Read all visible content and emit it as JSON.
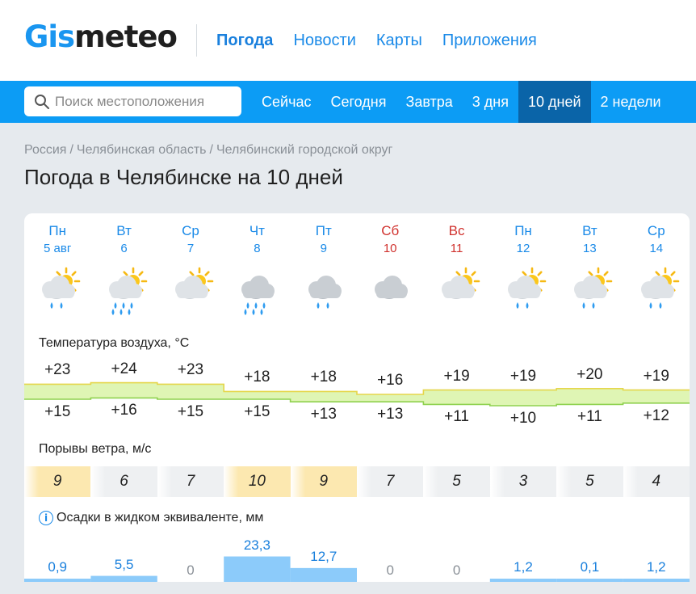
{
  "header": {
    "logo": {
      "part1": "Gis",
      "part2": "meteo"
    },
    "nav": [
      {
        "label": "Погода",
        "active": true
      },
      {
        "label": "Новости",
        "active": false
      },
      {
        "label": "Карты",
        "active": false
      },
      {
        "label": "Приложения",
        "active": false
      }
    ]
  },
  "subnav": {
    "search_placeholder": "Поиск местоположения",
    "search_icon": "search-icon",
    "tabs": [
      {
        "label": "Сейчас",
        "active": false
      },
      {
        "label": "Сегодня",
        "active": false
      },
      {
        "label": "Завтра",
        "active": false
      },
      {
        "label": "3 дня",
        "active": false
      },
      {
        "label": "10 дней",
        "active": true
      },
      {
        "label": "2 недели",
        "active": false
      }
    ]
  },
  "breadcrumb": [
    "Россия",
    "Челябинская область",
    "Челябинский городской округ"
  ],
  "breadcrumb_separator": "/",
  "page_title": "Погода в Челябинске на 10 дней",
  "forecast": {
    "days": [
      {
        "dow": "Пн",
        "date": "5 авг",
        "weekend": false,
        "icon": "partly-cloudy-rain-icon"
      },
      {
        "dow": "Вт",
        "date": "6",
        "weekend": false,
        "icon": "partly-cloudy-heavy-rain-icon"
      },
      {
        "dow": "Ср",
        "date": "7",
        "weekend": false,
        "icon": "partly-cloudy-icon"
      },
      {
        "dow": "Чт",
        "date": "8",
        "weekend": false,
        "icon": "cloudy-heavy-rain-icon"
      },
      {
        "dow": "Пт",
        "date": "9",
        "weekend": false,
        "icon": "cloudy-rain-icon"
      },
      {
        "dow": "Сб",
        "date": "10",
        "weekend": true,
        "icon": "cloudy-icon"
      },
      {
        "dow": "Вс",
        "date": "11",
        "weekend": true,
        "icon": "partly-cloudy-icon"
      },
      {
        "dow": "Пн",
        "date": "12",
        "weekend": false,
        "icon": "partly-cloudy-rain-icon"
      },
      {
        "dow": "Вт",
        "date": "13",
        "weekend": false,
        "icon": "partly-cloudy-rain-icon"
      },
      {
        "dow": "Ср",
        "date": "14",
        "weekend": false,
        "icon": "partly-cloudy-rain-icon"
      }
    ],
    "temperature": {
      "label": "Температура воздуха, °C",
      "max": [
        "+23",
        "+24",
        "+23",
        "+18",
        "+18",
        "+16",
        "+19",
        "+19",
        "+20",
        "+19"
      ],
      "min": [
        "+15",
        "+16",
        "+15",
        "+15",
        "+13",
        "+13",
        "+11",
        "+10",
        "+11",
        "+12"
      ]
    },
    "wind_gusts": {
      "label": "Порывы ветра, м/с",
      "values": [
        "9",
        "6",
        "7",
        "10",
        "9",
        "7",
        "5",
        "3",
        "5",
        "4"
      ]
    },
    "precipitation": {
      "label": "Осадки в жидком эквиваленте, мм",
      "values": [
        "0,9",
        "5,5",
        "0",
        "23,3",
        "12,7",
        "0",
        "0",
        "1,2",
        "0,1",
        "1,2"
      ]
    }
  },
  "colors": {
    "brand_blue": "#1a96f0",
    "nav_bar": "#0c9cf5",
    "active_tab": "#0a64a8",
    "weekend": "#d0312d",
    "gust_strong": "#fce8b0",
    "gust_light": "#eef0f2",
    "precip_fill": "#8ccbfa",
    "temp_band": "#dff5b4"
  }
}
